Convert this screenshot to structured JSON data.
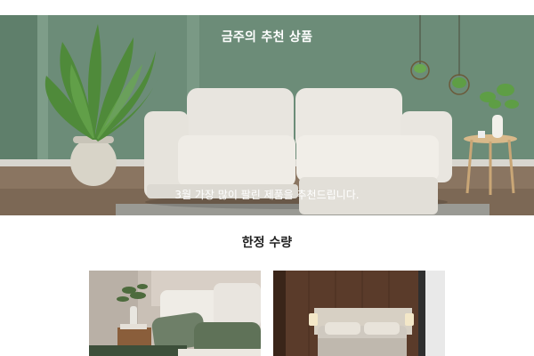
{
  "hero": {
    "title": "금주의 추천 상품",
    "subtitle": "3월 가장 많이 팔린 제품을 추천드립니다."
  },
  "section": {
    "title": "한정 수량"
  },
  "products": [
    {
      "image": "bedroom-with-green-pillows-photo"
    },
    {
      "image": "bedroom-with-wood-panel-wall-photo"
    }
  ],
  "colors": {
    "wall_green": "#6f8f7b",
    "sofa_white": "#e9e6e0",
    "floor_wood": "#8d7762",
    "title_text": "#222222"
  }
}
